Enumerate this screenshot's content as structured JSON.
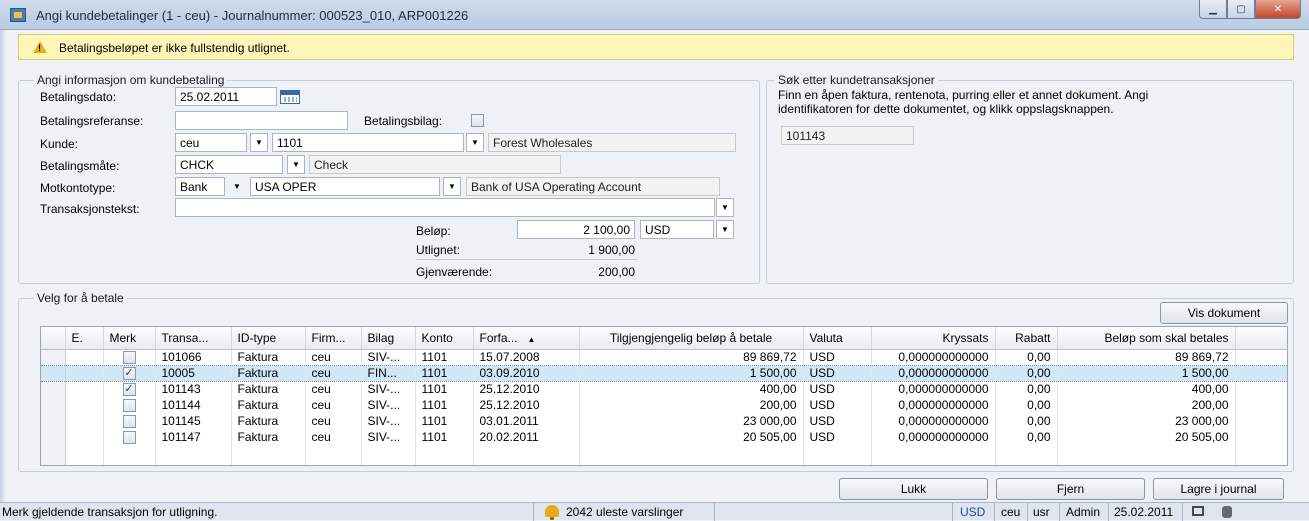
{
  "window": {
    "title": "Angi kundebetalinger (1 - ceu) - Journalnummer: 000523_010, ARP001226",
    "minimize": "▁",
    "maximize": "▢",
    "close": "✕"
  },
  "warning": {
    "text": "Betalingsbeløpet er ikke fullstendig utlignet."
  },
  "payment_info": {
    "title": "Angi informasjon om kundebetaling",
    "payment_date_label": "Betalingsdato:",
    "payment_date_value": "25.02.2011",
    "payment_ref_label": "Betalingsreferanse:",
    "payment_ref_value": "",
    "payment_voucher_label": "Betalingsbilag:",
    "customer_label": "Kunde:",
    "customer_company": "ceu",
    "customer_account": "1101",
    "customer_name": "Forest Wholesales",
    "method_label": "Betalingsmåte:",
    "method_code": "CHCK",
    "method_name": "Check",
    "offset_type_label": "Motkontotype:",
    "offset_type_value": "Bank",
    "offset_account": "USA OPER",
    "offset_account_name": "Bank of USA Operating Account",
    "transaction_text_label": "Transaksjonstekst:",
    "transaction_text_value": "",
    "amount_label": "Beløp:",
    "amount_value": "2 100,00",
    "currency_value": "USD",
    "settled_label": "Utlignet:",
    "settled_value": "1 900,00",
    "remaining_label": "Gjenværende:",
    "remaining_value": "200,00"
  },
  "search": {
    "title": "Søk etter kundetransaksjoner",
    "description": "Finn en åpen faktura, rentenota, purring eller et annet dokument. Angi identifikatoren for dette dokumentet, og klikk oppslagsknappen.",
    "value": "101143"
  },
  "select": {
    "title": "Velg for å betale",
    "view_document_button": "Vis dokument"
  },
  "grid": {
    "columns": [
      "E.",
      "Merk",
      "Transa...",
      "ID-type",
      "Firm...",
      "Bilag",
      "Konto",
      "Forfa...",
      "Tilgjengjengelig beløp å betale",
      "Valuta",
      "Kryssats",
      "Rabatt",
      "Beløp som skal betales"
    ],
    "sort_indicator": "▲",
    "rows": [
      {
        "checked": false,
        "trans": "101066",
        "idtype": "Faktura",
        "company": "ceu",
        "voucher": "SIV-...",
        "account": "1101",
        "due": "15.07.2008",
        "available": "89 869,72",
        "currency": "USD",
        "rate": "0,000000000000",
        "discount": "0,00",
        "pay": "89 869,72",
        "selected": false
      },
      {
        "checked": true,
        "trans": "10005",
        "idtype": "Faktura",
        "company": "ceu",
        "voucher": "FIN...",
        "account": "1101",
        "due": "03.09.2010",
        "available": "1 500,00",
        "currency": "USD",
        "rate": "0,000000000000",
        "discount": "0,00",
        "pay": "1 500,00",
        "selected": true
      },
      {
        "checked": true,
        "trans": "101143",
        "idtype": "Faktura",
        "company": "ceu",
        "voucher": "SIV-...",
        "account": "1101",
        "due": "25.12.2010",
        "available": "400,00",
        "currency": "USD",
        "rate": "0,000000000000",
        "discount": "0,00",
        "pay": "400,00",
        "selected": false
      },
      {
        "checked": false,
        "trans": "101144",
        "idtype": "Faktura",
        "company": "ceu",
        "voucher": "SIV-...",
        "account": "1101",
        "due": "25.12.2010",
        "available": "200,00",
        "currency": "USD",
        "rate": "0,000000000000",
        "discount": "0,00",
        "pay": "200,00",
        "selected": false
      },
      {
        "checked": false,
        "trans": "101145",
        "idtype": "Faktura",
        "company": "ceu",
        "voucher": "SIV-...",
        "account": "1101",
        "due": "03.01.2011",
        "available": "23 000,00",
        "currency": "USD",
        "rate": "0,000000000000",
        "discount": "0,00",
        "pay": "23 000,00",
        "selected": false
      },
      {
        "checked": false,
        "trans": "101147",
        "idtype": "Faktura",
        "company": "ceu",
        "voucher": "SIV-...",
        "account": "1101",
        "due": "20.02.2011",
        "available": "20 505,00",
        "currency": "USD",
        "rate": "0,000000000000",
        "discount": "0,00",
        "pay": "20 505,00",
        "selected": false
      }
    ]
  },
  "buttons": {
    "close": "Lukk",
    "remove": "Fjern",
    "save": "Lagre i journal"
  },
  "statusbar": {
    "help_text": "Merk gjeldende transaksjon for utligning.",
    "alerts": "2042 uleste varslinger",
    "currency": "USD",
    "company": "ceu",
    "layer": "usr",
    "user": "Admin",
    "date": "25.02.2011"
  }
}
